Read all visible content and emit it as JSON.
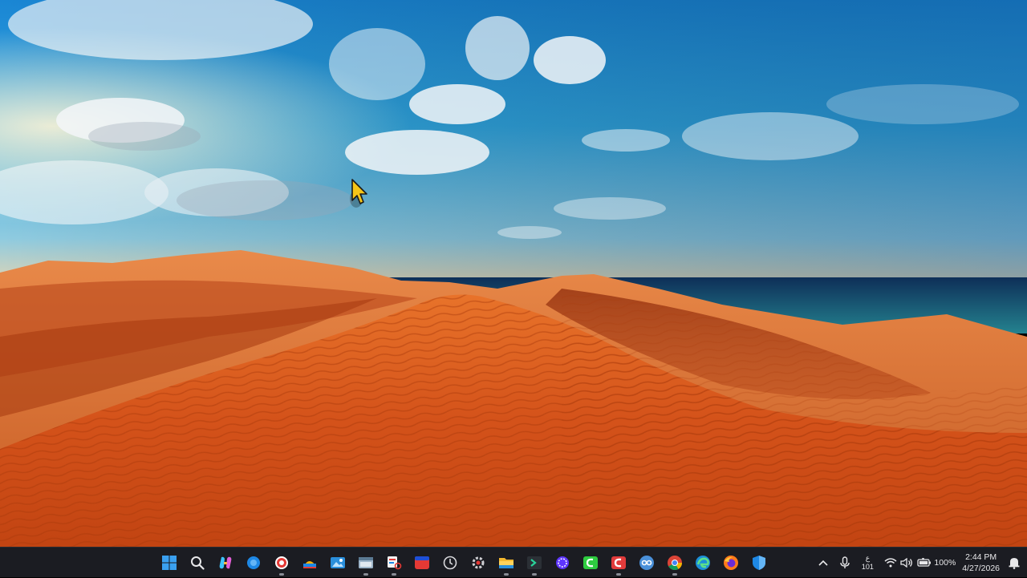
{
  "taskbar": {
    "apps": [
      {
        "name": "start-button",
        "icon": "windows-logo-icon"
      },
      {
        "name": "search-button",
        "icon": "search-icon"
      },
      {
        "name": "copilot-button",
        "icon": "copilot-icon"
      },
      {
        "name": "app-blue-circle-button",
        "icon": "blue-circle-icon"
      },
      {
        "name": "app-red-record-button",
        "icon": "record-icon"
      },
      {
        "name": "app-colorful-button",
        "icon": "colorful-app-icon"
      },
      {
        "name": "app-photos-button",
        "icon": "photos-icon"
      },
      {
        "name": "app-window-button",
        "icon": "window-app-icon"
      },
      {
        "name": "app-snipping-button",
        "icon": "snipping-tool-icon"
      },
      {
        "name": "app-red-square-button",
        "icon": "red-app-icon"
      },
      {
        "name": "app-clock-button",
        "icon": "clock-icon"
      },
      {
        "name": "app-settings-button",
        "icon": "gear-icon"
      },
      {
        "name": "file-explorer-button",
        "icon": "folder-icon"
      },
      {
        "name": "app-terminal-button",
        "icon": "terminal-icon"
      },
      {
        "name": "app-purple-circle-button",
        "icon": "purple-circle-icon"
      },
      {
        "name": "app-green-square-button",
        "icon": "green-app-icon"
      },
      {
        "name": "app-red-c-button",
        "icon": "red-c-app-icon"
      },
      {
        "name": "qbittorrent-button",
        "icon": "qbittorrent-icon"
      },
      {
        "name": "chrome-button",
        "icon": "chrome-icon"
      },
      {
        "name": "edge-button",
        "icon": "edge-icon"
      },
      {
        "name": "firefox-button",
        "icon": "firefox-icon"
      },
      {
        "name": "defender-button",
        "icon": "shield-icon"
      }
    ],
    "tray": {
      "language_top": "ع",
      "language_bottom": "101",
      "battery_percent": "100%",
      "time": "2:44 PM",
      "date": "4/27/2026"
    }
  },
  "colors": {
    "taskbar_bg": "#1b1c22",
    "sky_top": "#1a88d6",
    "sand": "#d8531a",
    "sea": "#1d5c6e"
  }
}
